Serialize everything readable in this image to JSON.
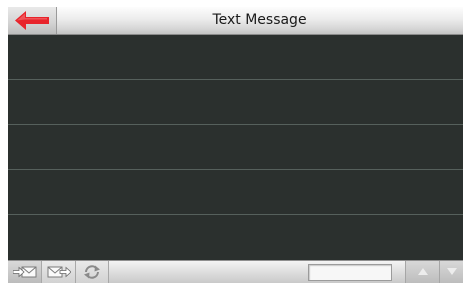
{
  "header": {
    "title": "Text Message",
    "back_icon": "back-arrow-icon",
    "back_color": "#e8232a"
  },
  "messages": {
    "rows": [
      "",
      "",
      "",
      "",
      ""
    ]
  },
  "toolbar": {
    "buttons": [
      {
        "name": "inbox",
        "icon": "inbox-icon",
        "selected": true
      },
      {
        "name": "outbox",
        "icon": "outbox-icon",
        "selected": false
      },
      {
        "name": "sync",
        "icon": "sync-icon",
        "selected": false
      }
    ],
    "page_field_value": "",
    "scroll_up_icon": "arrow-up-icon",
    "scroll_down_icon": "arrow-down-icon"
  },
  "colors": {
    "list_background": "#2b302e",
    "row_divider": "#56605c"
  }
}
